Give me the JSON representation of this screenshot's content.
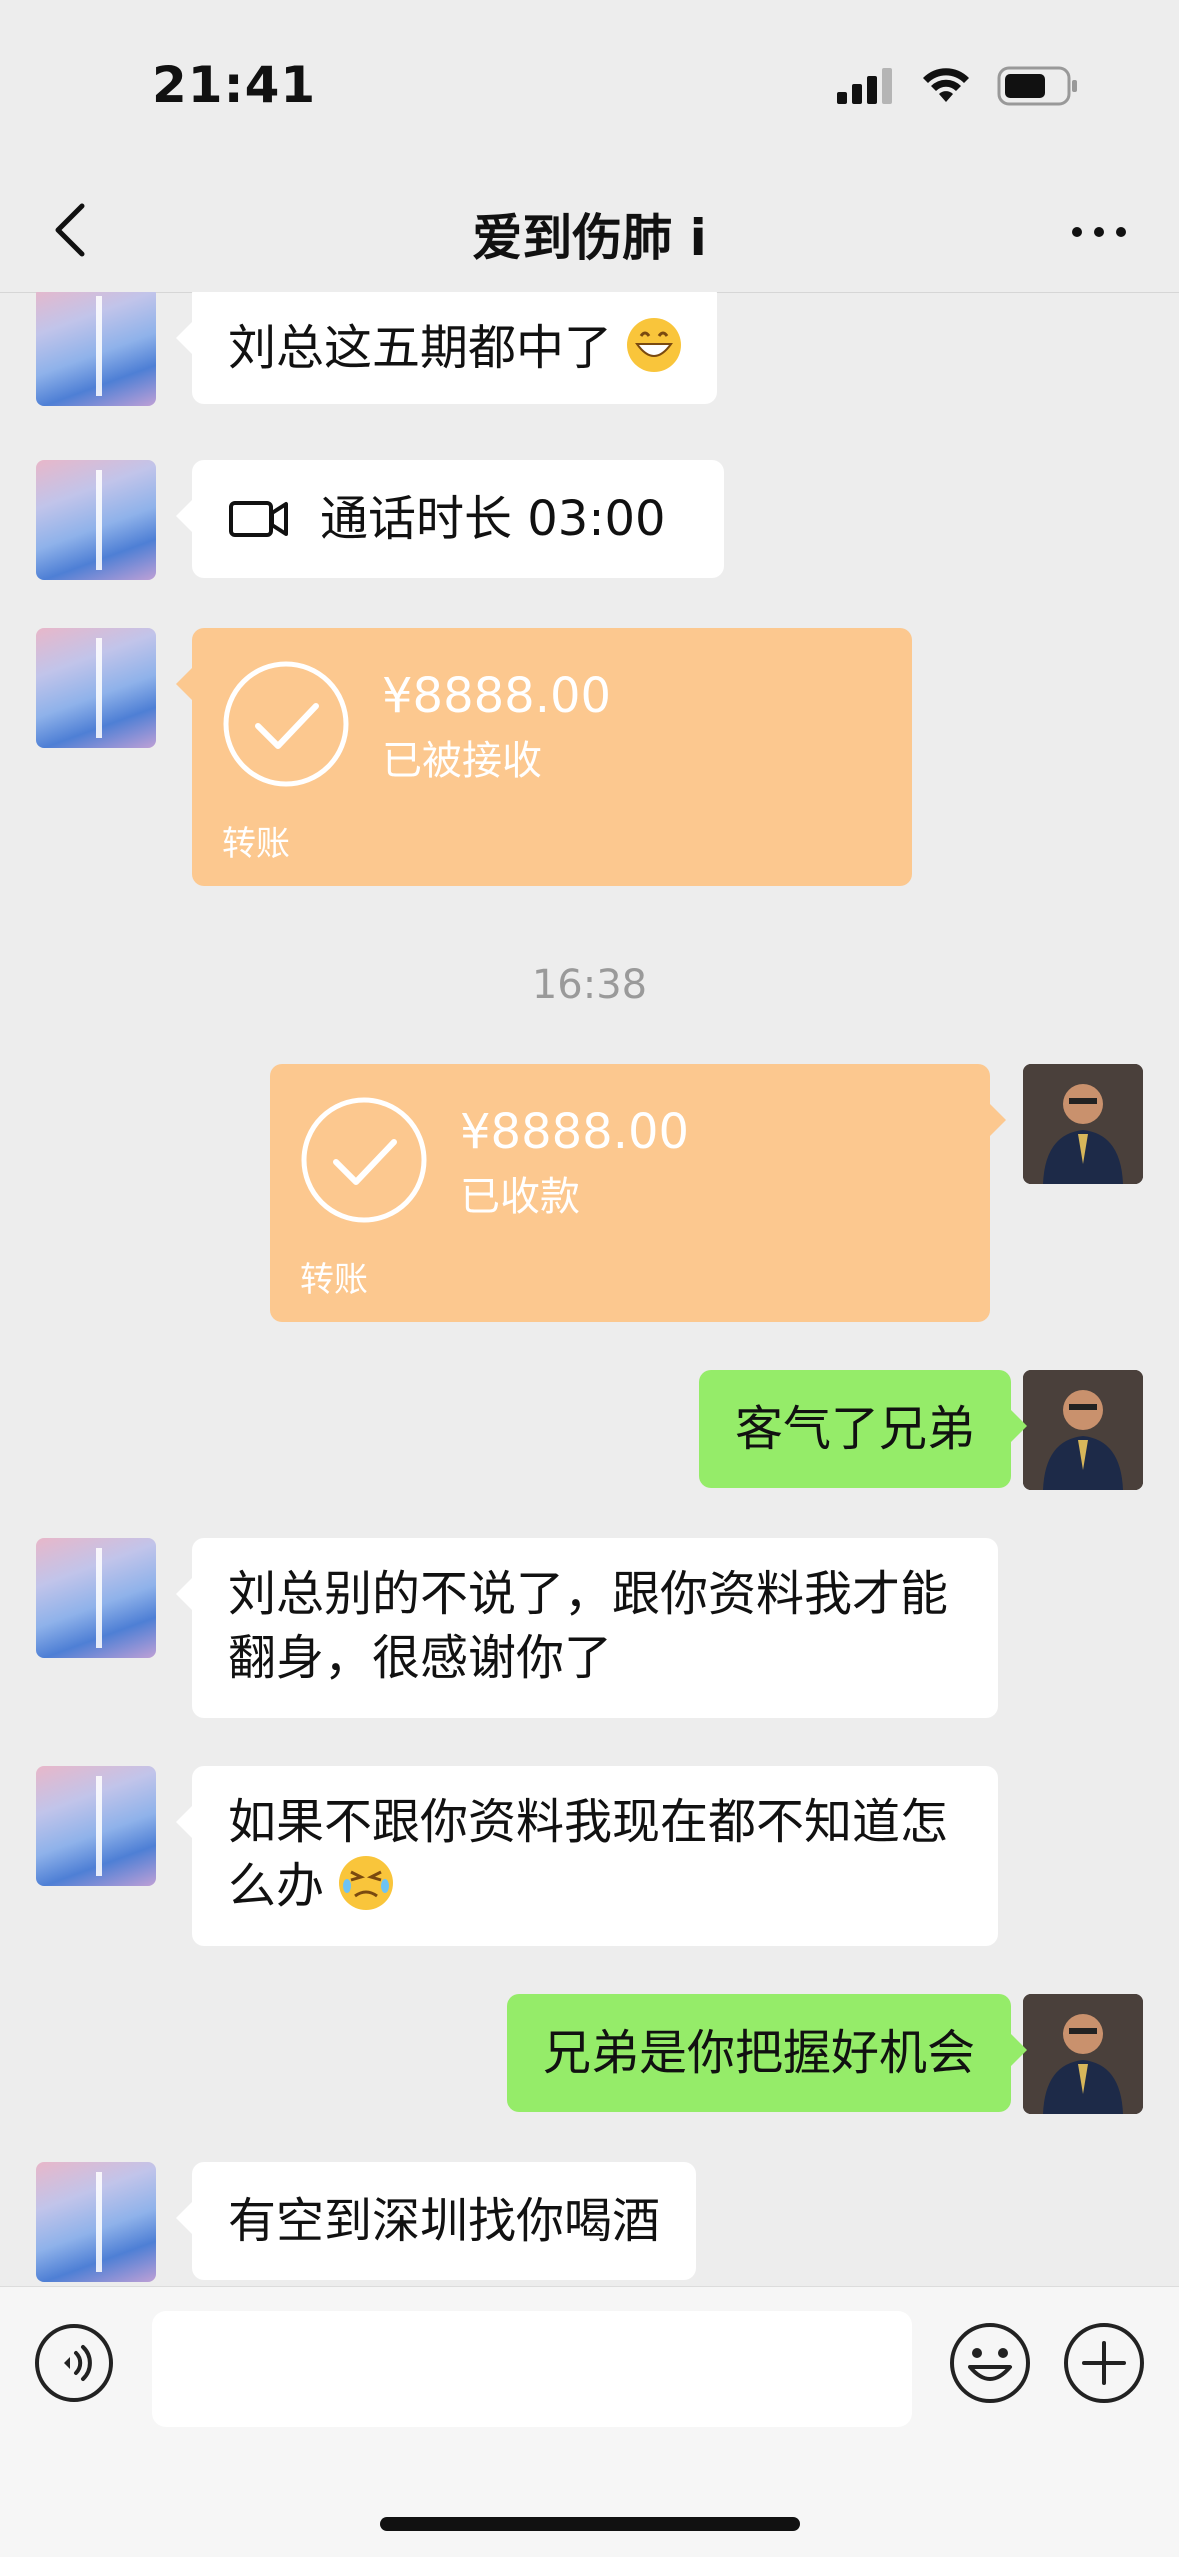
{
  "status_bar": {
    "time": "21:41"
  },
  "nav": {
    "title": "爱到伤肺 i"
  },
  "messages": {
    "m1": {
      "text": "刘总这五期都中了",
      "emoji": "grinning-face-emoji"
    },
    "m2": {
      "call_label": "通话时长 03:00"
    },
    "m3": {
      "amount": "¥8888.00",
      "status": "已被接收",
      "label": "转账"
    },
    "timestamp": "16:38",
    "m4": {
      "amount": "¥8888.00",
      "status": "已收款",
      "label": "转账"
    },
    "m5": {
      "text": "客气了兄弟"
    },
    "m6": {
      "text": "刘总别的不说了，跟你资料我才能翻身，很感谢你了"
    },
    "m7": {
      "text": "如果不跟你资料我现在都不知道怎么办",
      "emoji": "persevering-face-emoji"
    },
    "m8": {
      "text": "兄弟是你把握好机会"
    },
    "m9": {
      "text": "有空到深圳找你喝酒"
    }
  },
  "colors": {
    "background": "#ededed",
    "green_bubble": "#95ec69",
    "transfer_bubble": "#fcc88f"
  }
}
